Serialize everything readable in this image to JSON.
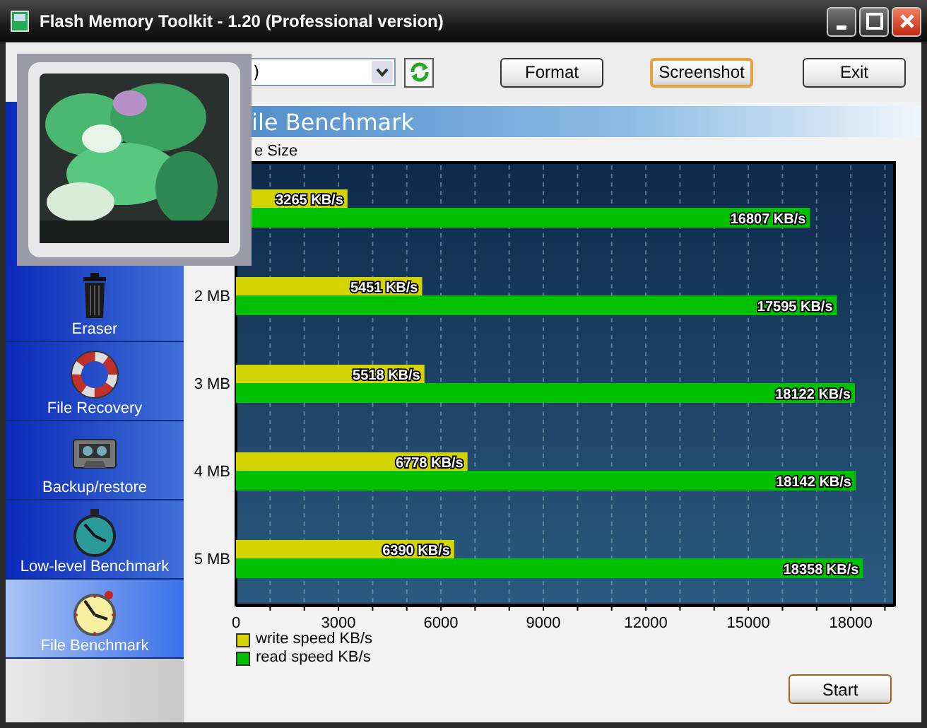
{
  "window": {
    "title": "Flash Memory Toolkit - 1.20 (Professional version)"
  },
  "toolbar": {
    "drive_select": {
      "value": ")"
    },
    "buttons": [
      {
        "label": "Format",
        "focused": false
      },
      {
        "label": "Screenshot",
        "focused": true
      },
      {
        "label": "Exit",
        "focused": false
      }
    ]
  },
  "sidebar": {
    "items": [
      {
        "label": "Eraser",
        "kind": "trash",
        "selected": false
      },
      {
        "label": "File Recovery",
        "kind": "lifebuoy",
        "selected": false
      },
      {
        "label": "Backup/restore",
        "kind": "cassette",
        "selected": false
      },
      {
        "label": "Low-level Benchmark",
        "kind": "stopwatch",
        "selected": false
      },
      {
        "label": "File Benchmark",
        "kind": "clock",
        "selected": true
      }
    ]
  },
  "panel": {
    "title": "ile Benchmark",
    "axis_caption": "e Size",
    "chart_data": {
      "type": "bar",
      "orientation": "horizontal",
      "categories": [
        null,
        "2 MB",
        "3 MB",
        "4 MB",
        "5 MB"
      ],
      "series": [
        {
          "name": "write speed KB/s",
          "color": "#d4d400",
          "values": [
            3265,
            5451,
            5518,
            6778,
            6390
          ],
          "value_labels": [
            "3265 KB/s",
            "5451 KB/s",
            "5518 KB/s",
            "6778 KB/s",
            "6390 KB/s"
          ]
        },
        {
          "name": "read speed KB/s",
          "color": "#00c000",
          "values": [
            16807,
            17595,
            18122,
            18142,
            18358
          ],
          "value_labels": [
            "16807 KB/s",
            "17595 KB/s",
            "18122 KB/s",
            "18142 KB/s",
            "18358 KB/s"
          ]
        }
      ],
      "xlim": [
        0,
        19280
      ],
      "grid": true,
      "xticks": [
        0,
        3000,
        6000,
        9000,
        12000,
        15000,
        18000
      ],
      "data_labels": true
    },
    "start_button": {
      "label": "Start"
    }
  }
}
